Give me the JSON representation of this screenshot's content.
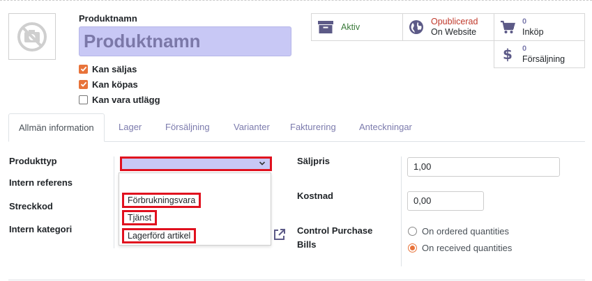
{
  "product": {
    "name_label": "Produktnamn",
    "name_value": "Produktnamn",
    "checkboxes": [
      {
        "label": "Kan säljas",
        "checked": true
      },
      {
        "label": "Kan köpas",
        "checked": true
      },
      {
        "label": "Kan vara utlägg",
        "checked": false
      }
    ]
  },
  "stats": {
    "active": {
      "label": "Aktiv",
      "icon": "archive-icon",
      "color": "#3a7a3a"
    },
    "website": {
      "line1": "Opublicerad",
      "line2": "On Website",
      "icon": "globe-icon",
      "line1_color": "#c0392b"
    },
    "purchase": {
      "count": "0",
      "label": "Inköp",
      "icon": "cart-icon"
    },
    "sales": {
      "count": "0",
      "label": "Försäljning",
      "icon": "dollar-icon"
    }
  },
  "tabs": [
    {
      "label": "Allmän information",
      "active": true
    },
    {
      "label": "Lager"
    },
    {
      "label": "Försäljning"
    },
    {
      "label": "Varianter"
    },
    {
      "label": "Fakturering"
    },
    {
      "label": "Anteckningar"
    }
  ],
  "general": {
    "labels": {
      "product_type": "Produkttyp",
      "internal_ref": "Intern referens",
      "barcode": "Streckkod",
      "internal_category": "Intern kategori",
      "sales_price": "Säljpris",
      "cost": "Kostnad",
      "control_bills": "Control Purchase Bills"
    },
    "product_type_options": [
      "Förbrukningsvara",
      "Tjänst",
      "Lagerförd artikel"
    ],
    "sales_price": "1,00",
    "cost": "0,00",
    "control_bills_options": [
      {
        "label": "On ordered quantities",
        "selected": false
      },
      {
        "label": "On received quantities",
        "selected": true
      }
    ]
  },
  "colors": {
    "accent": "#e8733a",
    "link": "#7c7bad",
    "highlight": "#e0101e",
    "field_bg": "#c8c8f5"
  }
}
